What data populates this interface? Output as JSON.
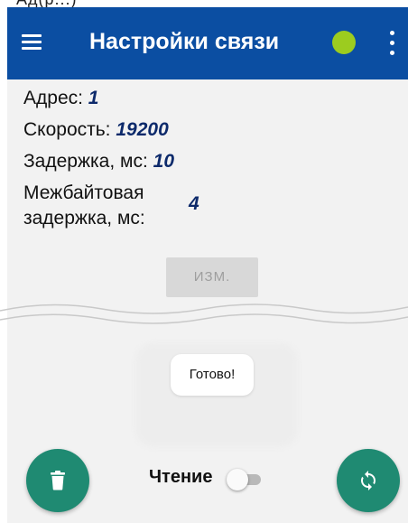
{
  "header_fragment": "Ад(р...)",
  "appbar": {
    "title": "Настройки связи",
    "status_color": "#9ccc1f",
    "background": "#0b4ea2"
  },
  "settings": {
    "address_label": "Адрес:",
    "address_value": "1",
    "speed_label": "Скорость:",
    "speed_value": "19200",
    "delay_label": "Задержка, мс:",
    "delay_value": "10",
    "interbyte_label_line1": "Межбайтовая",
    "interbyte_label_line2": "задержка, мс:",
    "interbyte_value": "4"
  },
  "change_button": {
    "label": "ИЗМ.",
    "enabled": false
  },
  "toast": {
    "text": "Готово!"
  },
  "bottom": {
    "read_label": "Чтение",
    "read_toggle_on": false,
    "delete_icon": "trash-icon",
    "sync_icon": "sync-icon",
    "fab_color": "#1f8a72"
  }
}
